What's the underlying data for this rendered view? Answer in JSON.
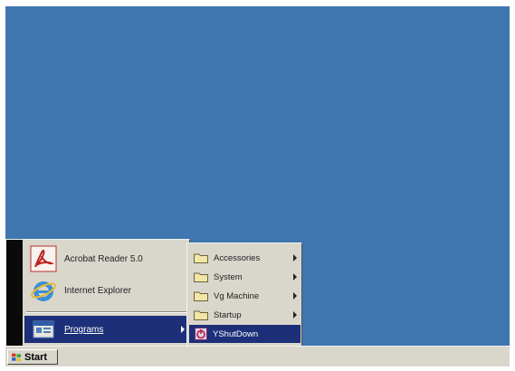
{
  "start_menu": {
    "items": [
      {
        "label": "Acrobat Reader 5.0",
        "icon": "acrobat-reader-icon"
      },
      {
        "label": "Internet Explorer",
        "icon": "internet-explorer-icon"
      },
      {
        "label": "Programs",
        "icon": "programs-icon",
        "has_submenu": true
      }
    ]
  },
  "programs_submenu": {
    "items": [
      {
        "label": "Accessories",
        "icon": "folder-icon",
        "has_submenu": true
      },
      {
        "label": "System",
        "icon": "folder-icon",
        "has_submenu": true
      },
      {
        "label": "Vg Machine",
        "icon": "folder-icon",
        "has_submenu": true
      },
      {
        "label": "Startup",
        "icon": "folder-icon",
        "has_submenu": true
      },
      {
        "label": "YShutDown",
        "icon": "shutdown-app-icon"
      }
    ]
  },
  "taskbar": {
    "start_label": "Start"
  },
  "colors": {
    "desktop": "#3f76b0",
    "menu": "#d9d6cc",
    "highlight": "#1c2f78",
    "banner": "#0a0a0a"
  }
}
